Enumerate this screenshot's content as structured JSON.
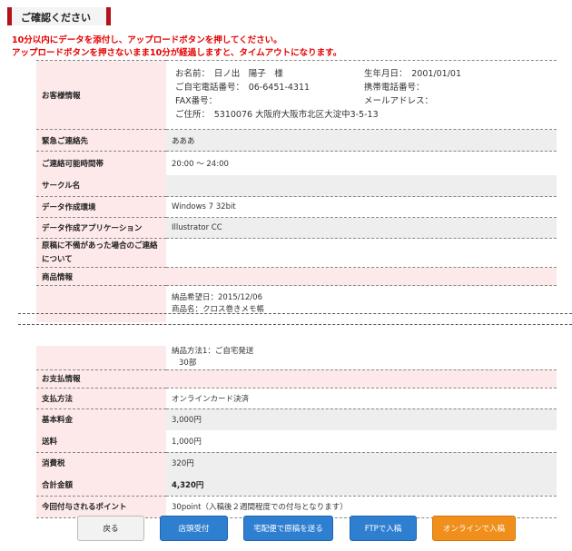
{
  "header": {
    "title": "ご確認ください"
  },
  "notice": {
    "line1": "10分以内にデータを添付し、アップロードボタンを押してください。",
    "line2": "アップロードボタンを押さないまま10分が経過しますと、タイムアウトになります。"
  },
  "customer": {
    "label": "お客様情報",
    "name": "お名前：　日ノ出　陽子　様",
    "birthday": "生年月日：　2001/01/01",
    "home_phone": "ご自宅電話番号：　06-6451-4311",
    "mobile_phone": "携帯電話番号：",
    "fax": "FAX番号：",
    "email": "メールアドレス：",
    "address": "ご住所：　5310076 大阪府大阪市北区大淀中3-5-13"
  },
  "rows": {
    "emergency": {
      "label": "緊急ご連絡先",
      "value": "あああ"
    },
    "contact_time": {
      "label": "ご連絡可能時間帯",
      "value": "20:00 〜 24:00"
    },
    "circle": {
      "label": "サークル名",
      "value": ""
    },
    "environment": {
      "label": "データ作成環境",
      "value": "Windows 7 32bit"
    },
    "application": {
      "label": "データ作成アプリケーション",
      "value": "Illustrator CC"
    },
    "defect_contact": {
      "label": "原稿に不備があった場合のご連絡について",
      "value": ""
    }
  },
  "product": {
    "section": "商品情報",
    "delivery_date": "納品希望日：2015/12/06",
    "product_name": "商品名：クロス巻きメモ帳",
    "delivery_method": "納品方法1：ご自宅発送",
    "quantity": "30部"
  },
  "payment": {
    "section": "お支払情報",
    "method": {
      "label": "支払方法",
      "value": "オンラインカード決済"
    },
    "base_fee": {
      "label": "基本料金",
      "value": "3,000円"
    },
    "shipping": {
      "label": "送料",
      "value": "1,000円"
    },
    "tax": {
      "label": "消費税",
      "value": "320円"
    },
    "total": {
      "label": "合計金額",
      "value": "4,320円"
    },
    "points": {
      "label": "今回付与されるポイント",
      "value": "30point（入稿後２週間程度での付与となります）"
    }
  },
  "buttons": {
    "back": "戻る",
    "store": "店頭受付",
    "mail": "宅配便で原稿を送る",
    "ftp": "FTPで入稿",
    "online": "オンラインで入稿"
  },
  "colors": {
    "accent": "#b4111a",
    "label_bg": "#fde9e9",
    "notice": "#e60000",
    "blue_button": "#2f7fd1",
    "orange_button": "#f08f1c"
  }
}
